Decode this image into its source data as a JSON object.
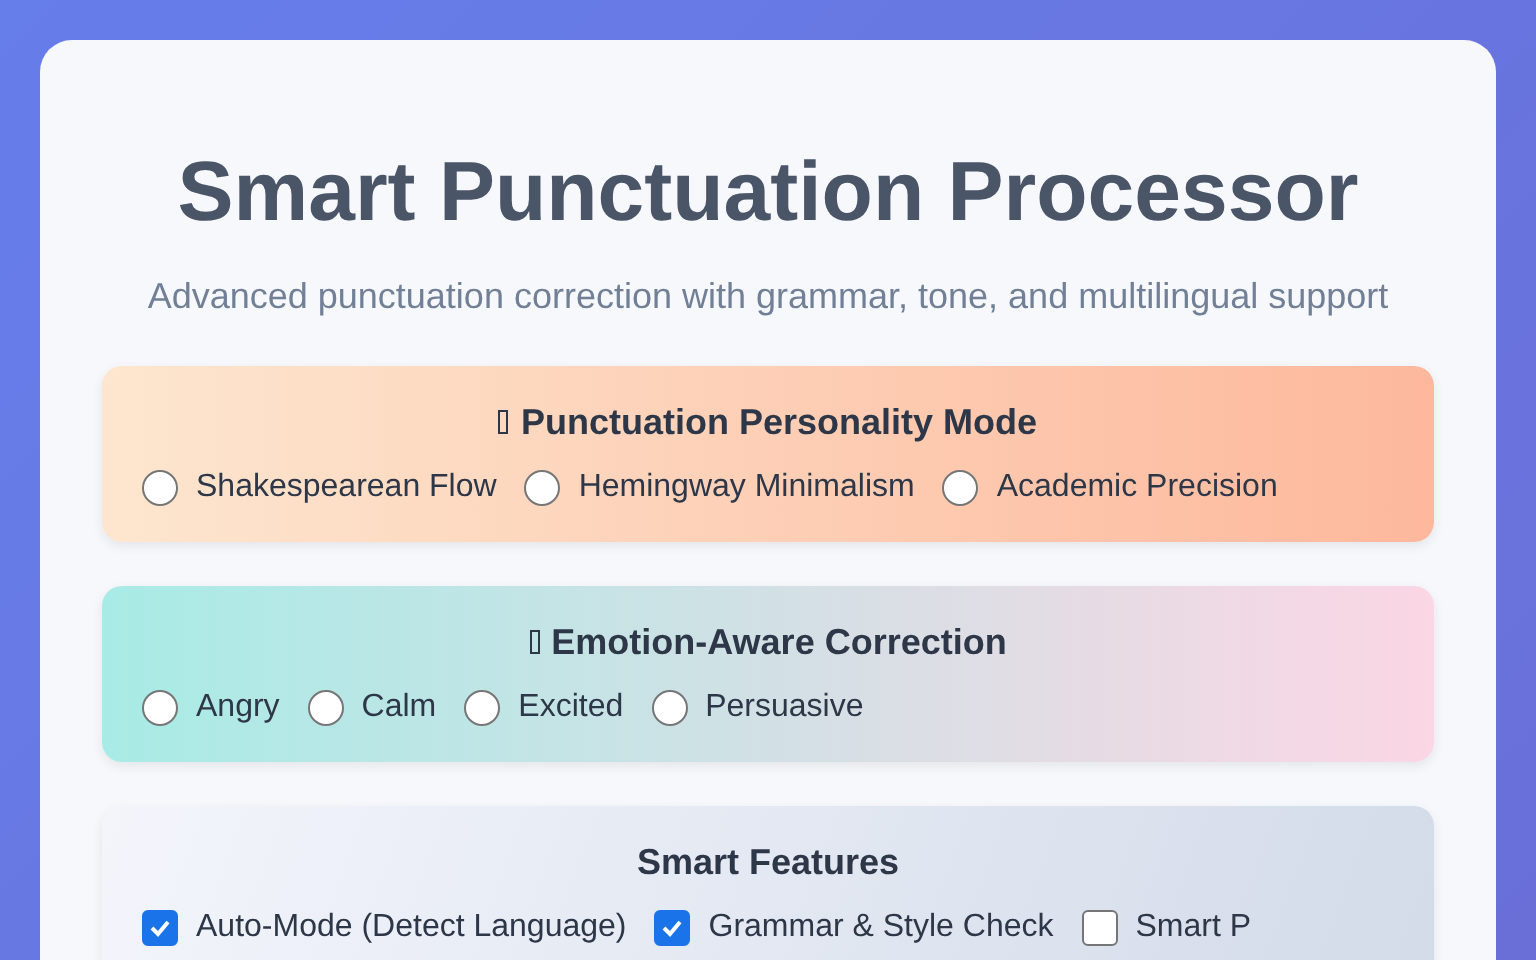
{
  "title": "Smart Punctuation Processor",
  "subtitle": "Advanced punctuation correction with grammar, tone, and multilingual support",
  "sections": [
    {
      "kind": "radio",
      "heading": "Punctuation Personality Mode",
      "options": [
        {
          "label": "Shakespearean Flow",
          "selected": false
        },
        {
          "label": "Hemingway Minimalism",
          "selected": false
        },
        {
          "label": "Academic Precision",
          "selected": false
        }
      ]
    },
    {
      "kind": "radio",
      "heading": "Emotion-Aware Correction",
      "options": [
        {
          "label": "Angry",
          "selected": false
        },
        {
          "label": "Calm",
          "selected": false
        },
        {
          "label": "Excited",
          "selected": false
        },
        {
          "label": "Persuasive",
          "selected": false
        }
      ]
    },
    {
      "kind": "checkbox",
      "heading": "Smart Features",
      "options": [
        {
          "label": "Auto-Mode (Detect Language)",
          "checked": true
        },
        {
          "label": "Grammar & Style Check",
          "checked": true
        },
        {
          "label": "Smart P",
          "checked": false
        }
      ]
    }
  ]
}
